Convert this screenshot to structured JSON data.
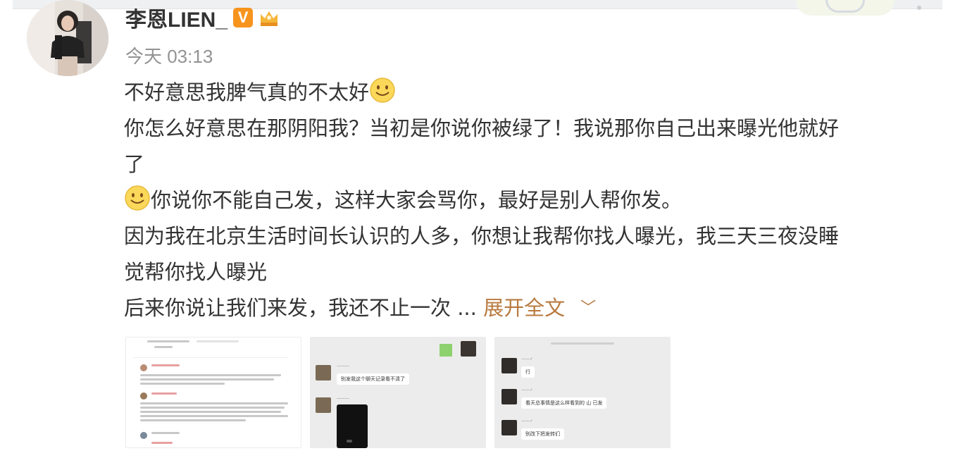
{
  "post": {
    "username": "李恩LIEN_",
    "verified_badge": "V",
    "timestamp": "今天 03:13",
    "lines": [
      "不好意思我脾气真的不太好",
      "你怎么好意思在那阴阳我？当初是你说你被绿了！我说那你自己出来曝光他就好",
      "了",
      "你说你不能自己发，这样大家会骂你，最好是别人帮你发。",
      "因为我在北京生活时间长认识的人多，你想让我帮你找人曝光，我三天三夜没睡",
      "觉帮你找人曝光",
      "后来你说让我们来发，我还不止一次 ..."
    ],
    "expand_label": "展开全文",
    "expand_icon": "chevron-down-icon",
    "emoji_icon": "smile-emoji-icon"
  },
  "thumbnails": {
    "t2": {
      "bubble1": "别发我这个聊天记录看不清了"
    },
    "t3": {
      "bubble1": "行",
      "bubble2": "看天总事情是这么样看到的 山 已发",
      "bubble3": "别改下把发转们"
    }
  },
  "colors": {
    "text": "#333333",
    "muted": "#939393",
    "link": "#b87a3f",
    "badge": "#f7941d"
  }
}
